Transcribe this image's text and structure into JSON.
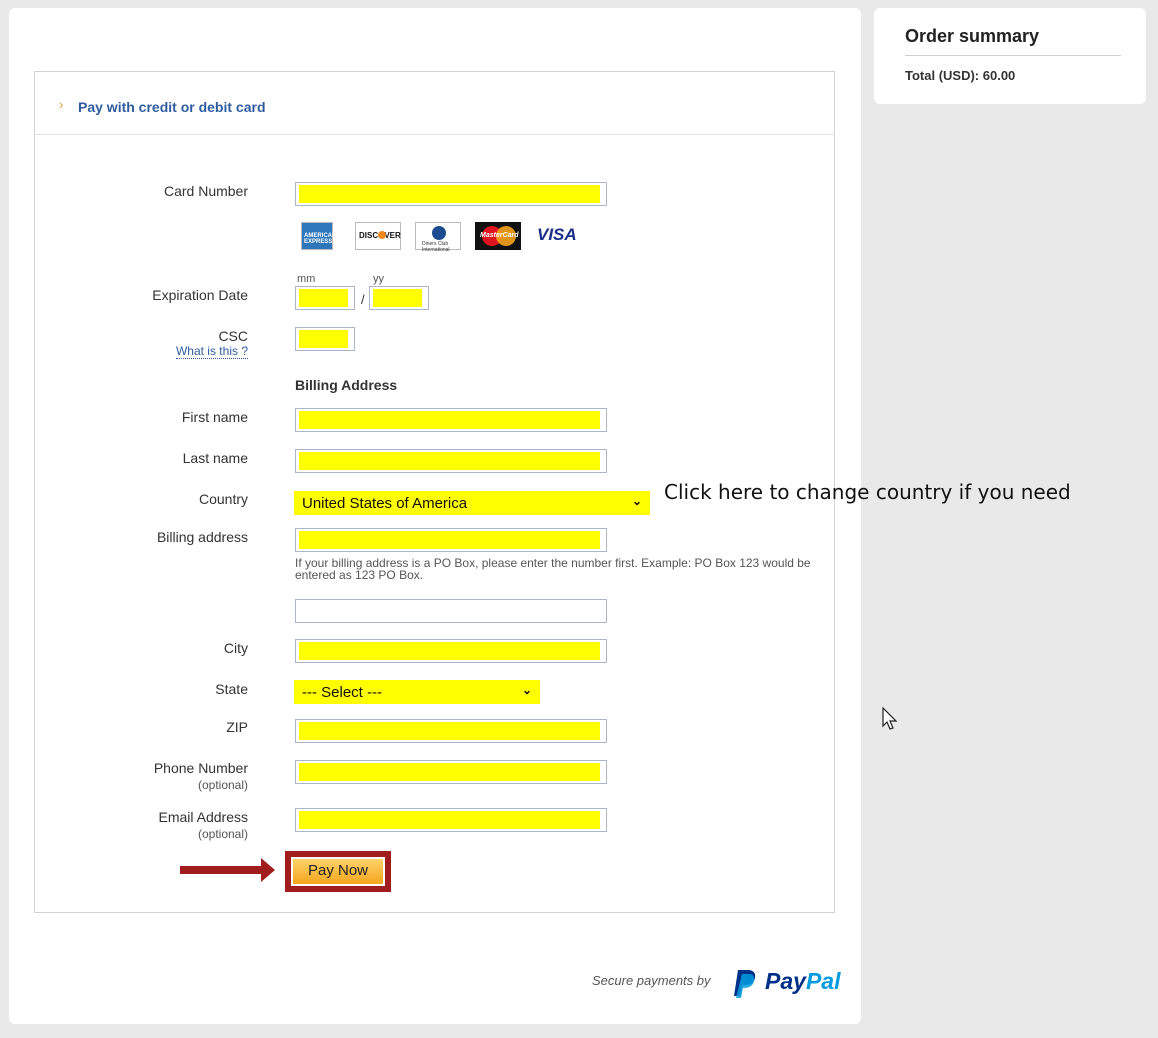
{
  "order_summary": {
    "title": "Order summary",
    "total": "Total (USD): 60.00"
  },
  "panel": {
    "title": "Pay with credit or debit card"
  },
  "form": {
    "card_number_label": "Card Number",
    "card_brands": [
      "american-express",
      "discover",
      "diners-club",
      "mastercard",
      "visa"
    ],
    "card_brand_text": {
      "amex": "AMERICAN EXPRESS",
      "discover": "DISCOVER",
      "diners": "Diners Club International",
      "mastercard": "MasterCard",
      "visa": "VISA"
    },
    "expiration_label": "Expiration Date",
    "mm_hint": "mm",
    "yy_hint": "yy",
    "slash": "/",
    "csc_label": "CSC",
    "csc_help": "What is this ?",
    "billing_heading": "Billing Address",
    "first_name_label": "First name",
    "last_name_label": "Last name",
    "country_label": "Country",
    "country_value": "United States of America",
    "billing_address_label": "Billing address",
    "po_box_note": "If your billing address is a PO Box, please enter the number first. Example: PO Box 123 would be entered as 123 PO Box.",
    "city_label": "City",
    "state_label": "State",
    "state_value": "--- Select ---",
    "zip_label": "ZIP",
    "phone_label": "Phone Number",
    "phone_optional": "(optional)",
    "email_label": "Email Address",
    "email_optional": "(optional)",
    "pay_button": "Pay Now"
  },
  "annotation": "Click here to change country if you need",
  "footer": {
    "secure_text": "Secure payments by",
    "paypal_pay": "Pay",
    "paypal_pal": "Pal"
  },
  "colors": {
    "field_highlight": "#ffff00",
    "annotation_red": "#a11d1d",
    "link_blue": "#2f5c9f",
    "paypal_dark": "#003087",
    "paypal_light": "#009cde"
  }
}
